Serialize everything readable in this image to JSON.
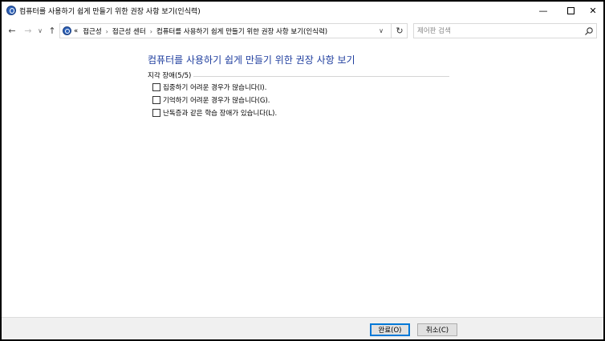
{
  "window": {
    "title": "컴퓨터를 사용하기 쉽게 만들기 위한 권장 사항 보기(인식력)",
    "controls": {
      "minimize": "—",
      "close": "✕"
    }
  },
  "nav": {
    "back": "←",
    "forward": "→",
    "recent": "∨",
    "up": "↑",
    "refresh": "↻",
    "dropdown": "∨"
  },
  "address": {
    "overflow": "«",
    "separator": "›",
    "crumbs": [
      "접근성",
      "접근성 센터",
      "컴퓨터를 사용하기 쉽게 만들기 위한 권장 사항 보기(인식력)"
    ]
  },
  "search": {
    "placeholder": "제어판 검색",
    "value": ""
  },
  "main": {
    "title": "컴퓨터를 사용하기 쉽게 만들기 위한 권장 사항 보기",
    "group_label": "지각 장애(5/5)",
    "options": [
      {
        "label": "집중하기 어려운 경우가 많습니다(I).",
        "checked": false
      },
      {
        "label": "기억하기 어려운 경우가 많습니다(G).",
        "checked": false
      },
      {
        "label": "난독증과 같은 학습 장애가 있습니다(L).",
        "checked": false
      }
    ]
  },
  "footer": {
    "ok_label": "완료(O)",
    "cancel_label": "취소(C)"
  },
  "colors": {
    "title_blue": "#1e3d9e",
    "ok_border": "#0078d7",
    "footer_bg": "#f0f0f0"
  }
}
